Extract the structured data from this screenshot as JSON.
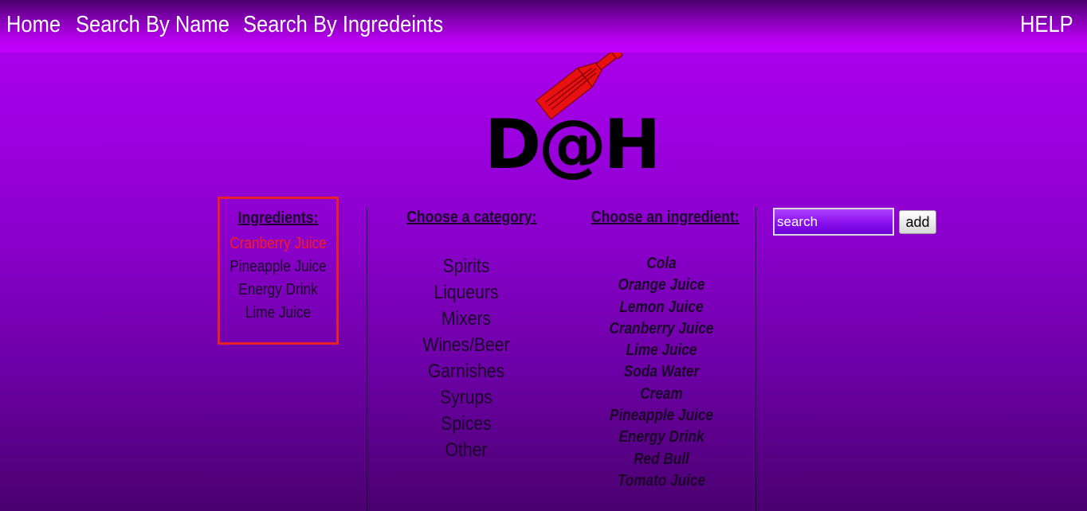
{
  "nav": {
    "home": "Home",
    "search_by_name": "Search By Name",
    "search_by_ingredients": "Search By Ingredeints",
    "help": "HELP"
  },
  "logo": {
    "text": "D@H",
    "icon": "bottle-icon",
    "bottle_color": "#e81010"
  },
  "selected_ingredients": {
    "heading": "Ingredients:",
    "items": [
      {
        "label": "Cranberry Juice",
        "active": true
      },
      {
        "label": "Pineapple Juice",
        "active": false
      },
      {
        "label": "Energy Drink",
        "active": false
      },
      {
        "label": "Lime Juice",
        "active": false
      }
    ]
  },
  "categories": {
    "heading": "Choose a category:",
    "items": [
      "Spirits",
      "Liqueurs",
      "Mixers",
      "Wines/Beer",
      "Garnishes",
      "Syrups",
      "Spices",
      "Other"
    ]
  },
  "ingredients": {
    "heading": "Choose an ingredient:",
    "items": [
      "Cola",
      "Orange Juice",
      "Lemon Juice",
      "Cranberry Juice",
      "Lime Juice",
      "Soda Water",
      "Cream",
      "Pineapple Juice",
      "Energy Drink",
      "Red Bull",
      "Tomato Juice"
    ]
  },
  "search": {
    "placeholder": "search",
    "add_label": "add"
  },
  "colors": {
    "highlight_border": "#e8202a",
    "active_item": "#ff1a1a"
  }
}
